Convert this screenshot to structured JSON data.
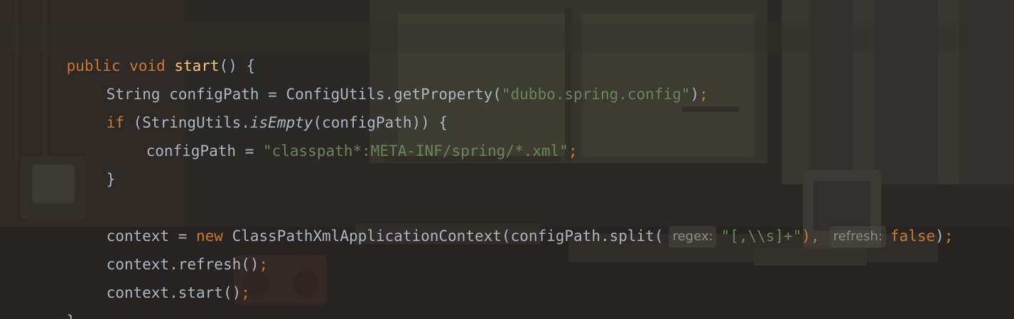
{
  "editor": {
    "background_colors": {
      "keyword": "#cc7832",
      "method": "#ffc66d",
      "string": "#6a8759",
      "identifier": "#a9b7c6",
      "hint": "#8f8c86"
    },
    "lines": {
      "l1": {
        "t1": "public",
        "t2": " ",
        "t3": "void",
        "t4": " ",
        "t5": "start",
        "t6": "() {"
      },
      "l2": {
        "t1": "String configPath = ConfigUtils.getProperty(",
        "t2": "\"dubbo.spring.config\"",
        "t3": ")",
        "t4": ";"
      },
      "l3": {
        "t1": "if",
        "t2": " (StringUtils.",
        "t3": "isEmpty",
        "t4": "(configPath)) {"
      },
      "l4": {
        "t1": "configPath = ",
        "t2": "\"classpath*:META-INF/spring/*.xml\"",
        "t3": ";"
      },
      "l5": {
        "t1": "}"
      },
      "l7": {
        "t1": "context = ",
        "t2": "new",
        "t3": " ClassPathXmlApplicationContext(configPath.split(",
        "hint1": "regex:",
        "t4": "\"[,\\\\s]+\"",
        "t5": "),",
        "hint2": "refresh:",
        "t6": "false",
        "t7": ")",
        "t8": ";"
      },
      "l8": {
        "t1": "context.refresh()",
        "t2": ";"
      },
      "l9": {
        "t1": "context.start()",
        "t2": ";"
      },
      "l10": {
        "t1": "}"
      }
    }
  }
}
